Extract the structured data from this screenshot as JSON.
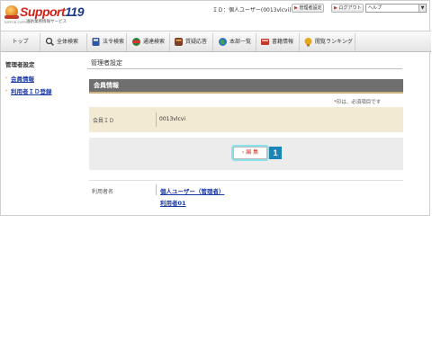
{
  "logo": {
    "brand": "Support",
    "number": "119",
    "tagline": "消防業務情報サービス",
    "small": "NIPPON SUPPORT"
  },
  "header": {
    "user_id": "ＩＤ：個人ユーザー(0013vlcvi)",
    "admin_button": "管理者設定",
    "logout_button": "ログアウト",
    "help_select": "ヘルプ"
  },
  "nav": {
    "tabs": [
      {
        "label": "トップ",
        "icon": "none"
      },
      {
        "label": "全体検索",
        "icon": "search-icon"
      },
      {
        "label": "法令検索",
        "icon": "law-book-icon"
      },
      {
        "label": "通達検索",
        "icon": "notice-globe-icon"
      },
      {
        "label": "質疑応答",
        "icon": "qa-book-icon"
      },
      {
        "label": "本部一覧",
        "icon": "globe-icon"
      },
      {
        "label": "書籍情報",
        "icon": "book-icon"
      },
      {
        "label": "閲覧ランキング",
        "icon": "ranking-icon"
      }
    ]
  },
  "sidebar": {
    "title": "管理者設定",
    "links": [
      "会員情報",
      "利用者ＩＤ登録"
    ]
  },
  "main": {
    "title": "管理者設定",
    "section": "会員情報",
    "required_mark": "*",
    "required_note": "印は、必須項目です",
    "member_id_label": "会員ＩＤ",
    "member_id_value": "0013vlcvi",
    "edit_button": "編 集",
    "edit_badge": "1",
    "users_label": "利用者名",
    "users": [
      "個人ユーザー（管理者）",
      "利用者01"
    ]
  },
  "colors": {
    "brand_red": "#d0241b",
    "link_blue": "#1a3aa8",
    "section_bar": "#6f6f6f",
    "member_row": "#f3ead3",
    "badge_blue": "#1a86b8"
  }
}
